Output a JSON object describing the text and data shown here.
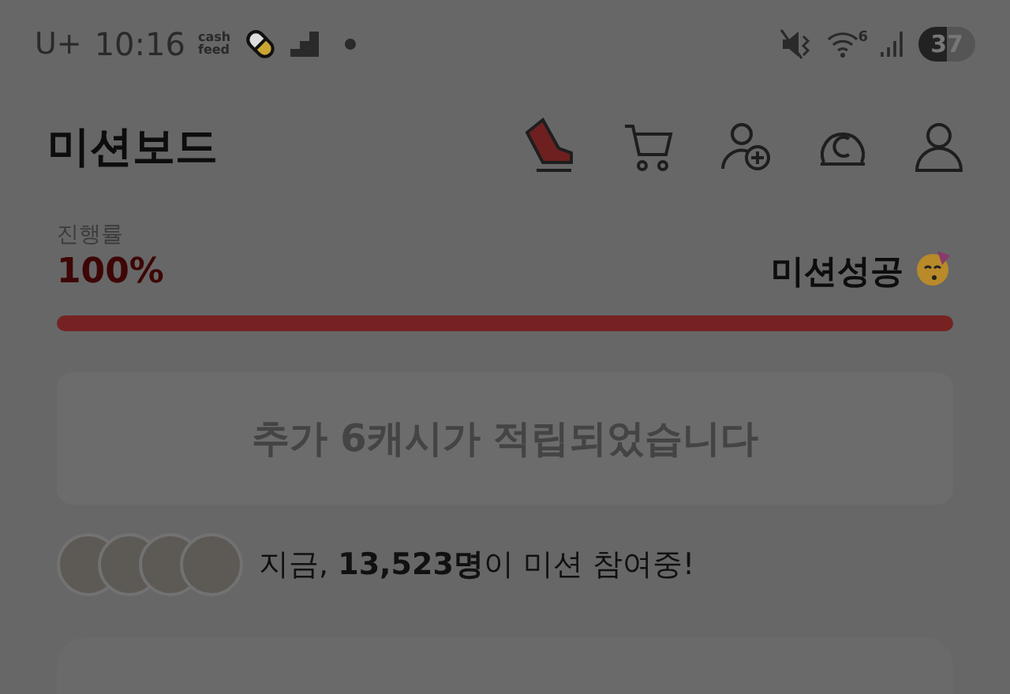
{
  "status_bar": {
    "carrier": "U+",
    "time": "10:16",
    "app_logo": [
      "cash",
      "feed"
    ],
    "wifi_label": "6",
    "battery": "37"
  },
  "header": {
    "title": "미션보드"
  },
  "progress": {
    "label": "진행률",
    "value": "100%",
    "status": "미션성공",
    "level": 1
  },
  "banner": {
    "text": "추가 6캐시가 적립되었습니다"
  },
  "participants": {
    "text": "지금, **13,523명**이 미션 참여중!"
  }
}
